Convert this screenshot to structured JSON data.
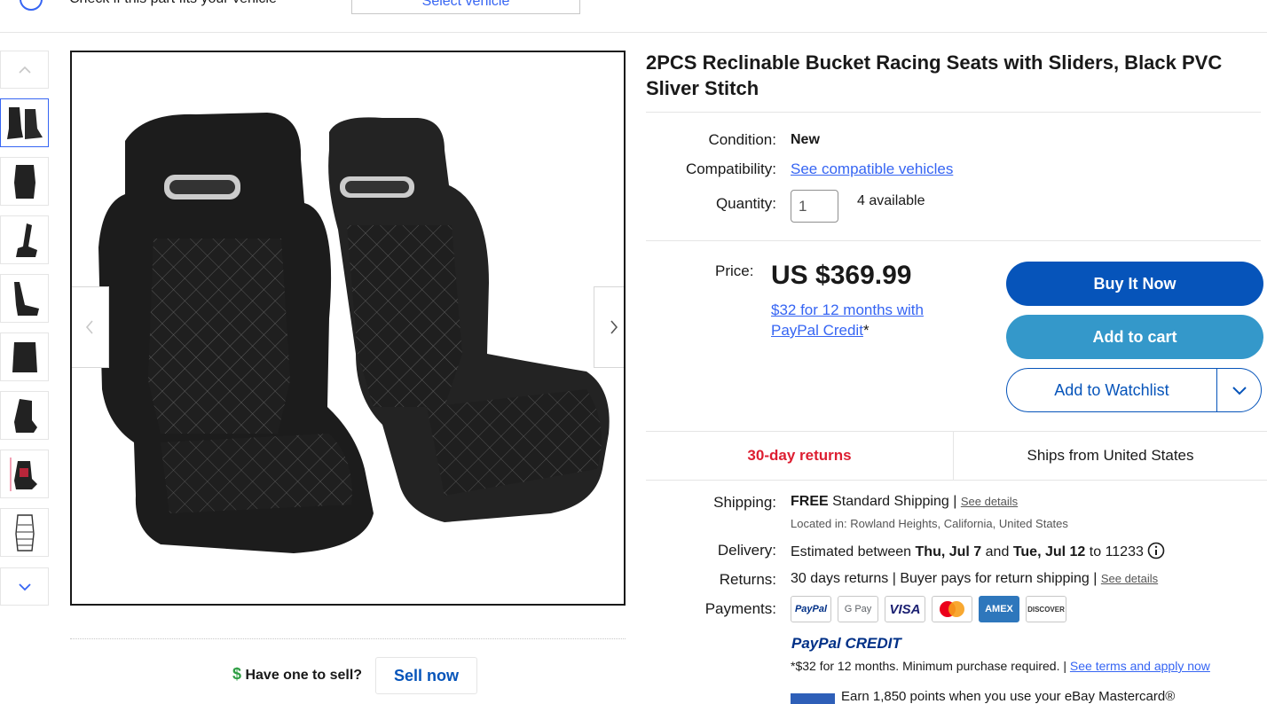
{
  "fit_bar": {
    "text": "Check if this part fits your vehicle",
    "button": "Select vehicle"
  },
  "gallery": {
    "thumb_count": 8,
    "active_index": 0
  },
  "sell": {
    "question": "Have one to sell?",
    "button": "Sell now"
  },
  "item": {
    "title": "2PCS Reclinable Bucket Racing Seats with Sliders, Black PVC Sliver Stitch",
    "condition_label": "Condition:",
    "condition_value": "New",
    "compat_label": "Compatibility:",
    "compat_link": "See compatible vehicles",
    "qty_label": "Quantity:",
    "qty_value": "1",
    "available": "4 available",
    "price_label": "Price:",
    "price": "US $369.99",
    "credit_link": "$32 for 12 months with PayPal Credit",
    "credit_asterisk": "*"
  },
  "actions": {
    "buy": "Buy It Now",
    "cart": "Add to cart",
    "watch": "Add to Watchlist"
  },
  "badges": {
    "returns": "30-day returns",
    "ships": "Ships from United States"
  },
  "shipping": {
    "label": "Shipping:",
    "free": "FREE",
    "method": "Standard Shipping",
    "sep": "|",
    "details": "See details",
    "location": "Located in: Rowland Heights, California, United States"
  },
  "delivery": {
    "label": "Delivery:",
    "pre": "Estimated between",
    "d1": "Thu, Jul 7",
    "and": "and",
    "d2": "Tue, Jul 12",
    "to": "to 11233"
  },
  "returns": {
    "label": "Returns:",
    "text": "30 days returns | Buyer pays for return shipping |",
    "details": "See details"
  },
  "payments": {
    "label": "Payments:",
    "methods": [
      "PayPal",
      "G Pay",
      "VISA",
      "Mastercard",
      "AMEX",
      "DISCOVER"
    ],
    "credit_logo": "PayPal CREDIT",
    "credit_note": "*$32 for 12 months. Minimum purchase required. |",
    "credit_terms": "See terms and apply now",
    "points": "Earn 1,850 points when you use your eBay Mastercard®"
  },
  "colors": {
    "link": "#3665f3",
    "buy_button": "#0654ba",
    "cart_button": "#3498ca",
    "returns_red": "#dd1e31"
  }
}
